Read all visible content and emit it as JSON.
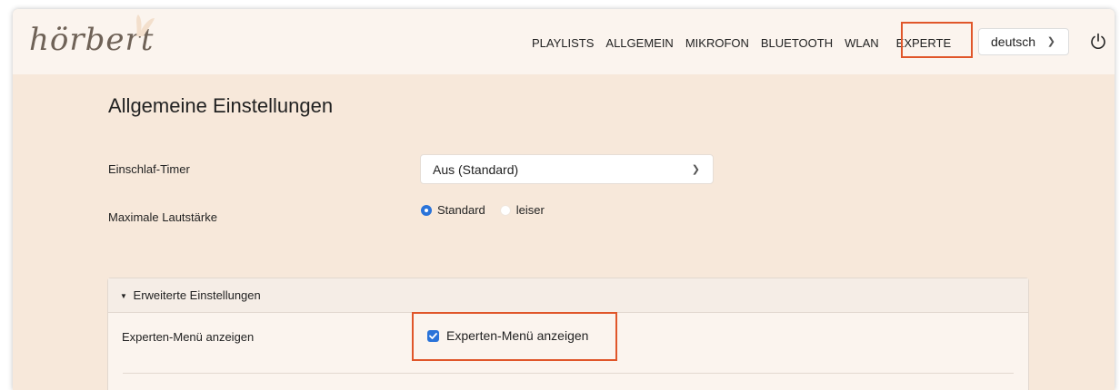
{
  "brand": {
    "logo_text": "hörbert"
  },
  "nav": {
    "items": [
      "PLAYLISTS",
      "ALLGEMEIN",
      "MIKROFON",
      "BLUETOOTH",
      "WLAN"
    ],
    "expert": "EXPERTE",
    "language": "deutsch"
  },
  "page": {
    "title": "Allgemeine Einstellungen"
  },
  "settings": {
    "sleep_timer": {
      "label": "Einschlaf-Timer",
      "value": "Aus (Standard)"
    },
    "max_volume": {
      "label": "Maximale Lautstärke",
      "options": [
        "Standard",
        "leiser"
      ],
      "selected": "Standard"
    }
  },
  "advanced": {
    "header": "Erweiterte Einstellungen",
    "expert_menu": {
      "label": "Experten-Menü anzeigen",
      "checkbox_label": "Experten-Menü anzeigen",
      "checked": true
    }
  },
  "colors": {
    "accent": "#2a73d9",
    "highlight": "#e0562a",
    "background": "#f7e8da",
    "navbar": "#fbf4ee"
  },
  "icons": {
    "power": "power-icon",
    "dropdown": "chevron-down-icon",
    "caret": "caret-down-icon",
    "check": "check-icon"
  }
}
